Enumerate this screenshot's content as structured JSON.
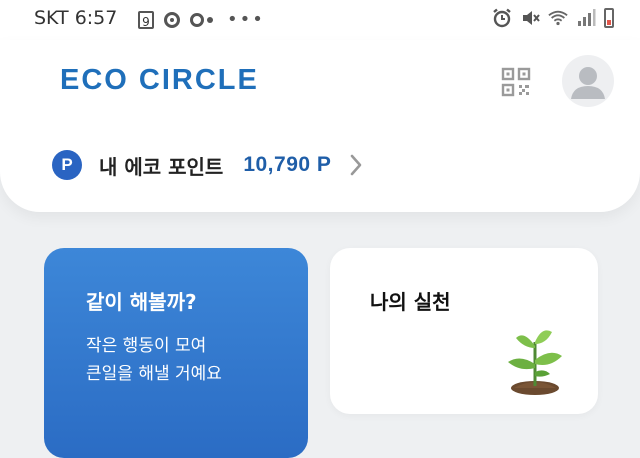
{
  "status_bar": {
    "carrier_time": "SKT 6:57",
    "notification_badge": "9",
    "icons_left": [
      "numbered-badge-icon",
      "sync-icon",
      "link-icon",
      "more-dots-icon"
    ],
    "icons_right": [
      "alarm-icon",
      "mute-icon",
      "wifi-icon",
      "signal-icon",
      "battery-icon"
    ],
    "battery_color": "#e2554a"
  },
  "header": {
    "app_title": "ECO CIRCLE",
    "brand_color": "#1f6fba",
    "qr_icon": "qr-code-icon",
    "avatar_icon": "person-icon"
  },
  "points": {
    "badge": "P",
    "label": "내 에코 포인트",
    "value": "10,790 P",
    "value_color": "#1f5ea8"
  },
  "cards": {
    "together": {
      "title": "같이 해볼까?",
      "description": "작은 행동이 모여\n큰일을 해낼 거예요",
      "color": "#2f74cc"
    },
    "practice": {
      "title": "나의 실천",
      "icon": "sprout-icon"
    }
  }
}
